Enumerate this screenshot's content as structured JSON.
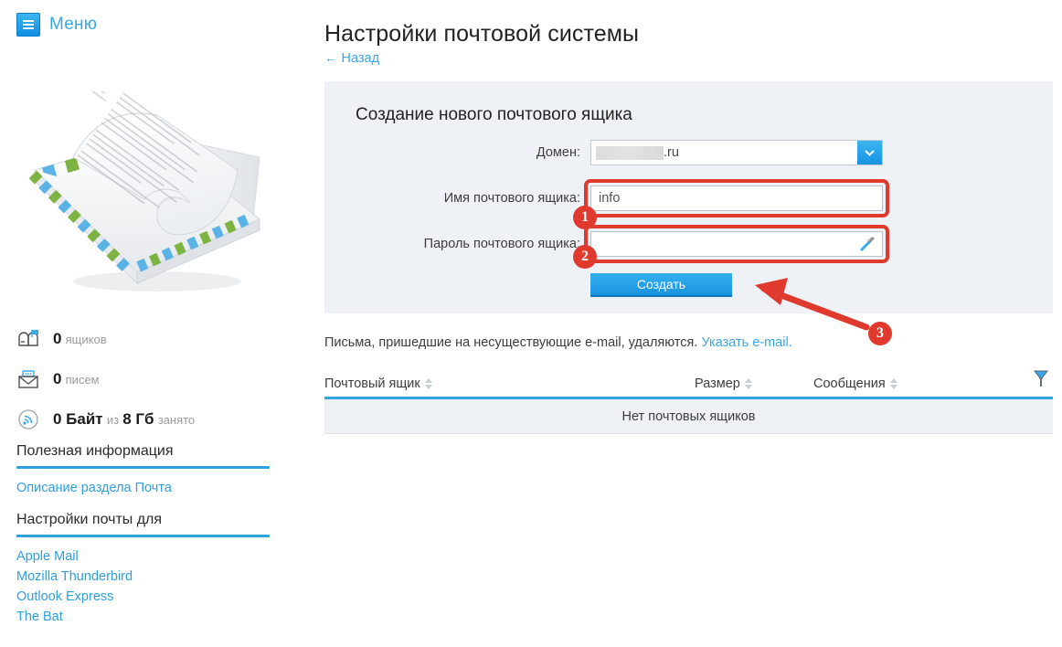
{
  "sidebar": {
    "menu": {
      "label": "Меню",
      "icon": "hamburger-icon"
    },
    "illustration": "airmail-envelope-letter-illustration",
    "stats": [
      {
        "icon": "mailbox-icon",
        "value": "0",
        "unit": "ящиков"
      },
      {
        "icon": "envelope-icon",
        "value": "0",
        "unit": "писем"
      },
      {
        "icon": "signal-icon",
        "value": "0 Байт",
        "mid": "из",
        "value2": "8 Гб",
        "unit": "занято"
      }
    ],
    "sections": [
      {
        "title": "Полезная информация",
        "links": [
          "Описание раздела Почта"
        ]
      },
      {
        "title": "Настройки почты для",
        "links": [
          "Apple Mail",
          "Mozilla Thunderbird",
          "Outlook Express",
          "The Bat"
        ]
      }
    ]
  },
  "main": {
    "page_title": "Настройки почтовой системы",
    "back_link": "← Назад",
    "panel": {
      "heading": "Создание нового почтового ящика",
      "domain": {
        "label": "Домен:",
        "redacted": true,
        "value_suffix": ".ru",
        "dropdown_icon": "chevron-down-icon"
      },
      "mailbox_name": {
        "label": "Имя почтового ящика:",
        "value": "info",
        "placeholder": ""
      },
      "mailbox_password": {
        "label": "Пароль почтового ящика:",
        "value": "",
        "placeholder": "",
        "generator_icon": "magic-wand-icon"
      },
      "submit_label": "Создать"
    },
    "note": {
      "text": "Письма, пришедшие на несуществующие e-mail, удаляются.",
      "link": "Указать e-mail."
    },
    "table": {
      "columns": [
        "Почтовый ящик",
        "Размер",
        "Сообщения"
      ],
      "filter_icon": "funnel-filter-icon",
      "empty_text": "Нет почтовых ящиков",
      "rows": []
    }
  },
  "annotations": {
    "badges": [
      "1",
      "2",
      "3"
    ],
    "arrow": "red-arrow-pointing-to-create-button",
    "color": "#e03a2f"
  },
  "colors": {
    "accent_blue": "#3aa8e8",
    "panel_bg": "#eef2f7",
    "annotation_red": "#e03a2f",
    "text_dark": "#2b2b2b"
  }
}
